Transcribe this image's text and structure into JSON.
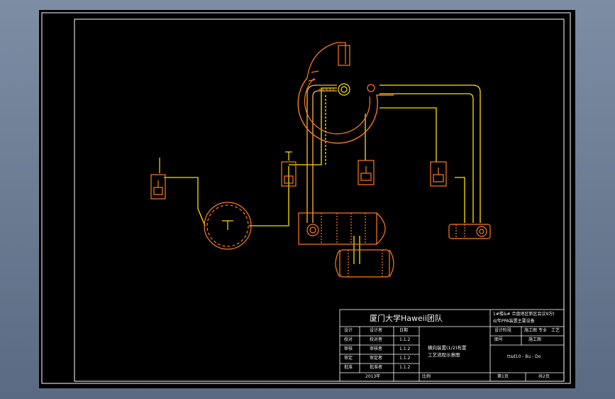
{
  "title_block": {
    "org_name": "厦门大学Haweii团队",
    "project_title_line1": "1#楼&#  合盘地区新区会议9万t",
    "project_title_line2": "d/年PPA装置主要设备",
    "drawing_name_line1": "横向装置(1/2)布置",
    "drawing_name_line2": "工艺流程示意图",
    "drawing_number": "ttsd10 - Bu - Do",
    "year": "2013年",
    "sheet_label": "第1页",
    "total_label": "共2页",
    "ratio_label": "比例",
    "right_row1": [
      "设计阶段",
      "施工图",
      "专业",
      "工艺"
    ],
    "right_row2": [
      "图号",
      "施工图"
    ],
    "rows": [
      {
        "role": "设计",
        "name": "设计者",
        "date": "日期"
      },
      {
        "role": "校对",
        "name": "校对者",
        "date": "1.1.2"
      },
      {
        "role": "审核",
        "name": "审核者",
        "date": "1.1.2"
      },
      {
        "role": "审定",
        "name": "审定者",
        "date": "1.1.2"
      },
      {
        "role": "批准",
        "name": "批准者",
        "date": "1.1.2"
      }
    ]
  },
  "colors": {
    "border": "#ffffff",
    "pipe": "#ffe000",
    "equipment": "#ff7a1a",
    "background": "#000000"
  }
}
